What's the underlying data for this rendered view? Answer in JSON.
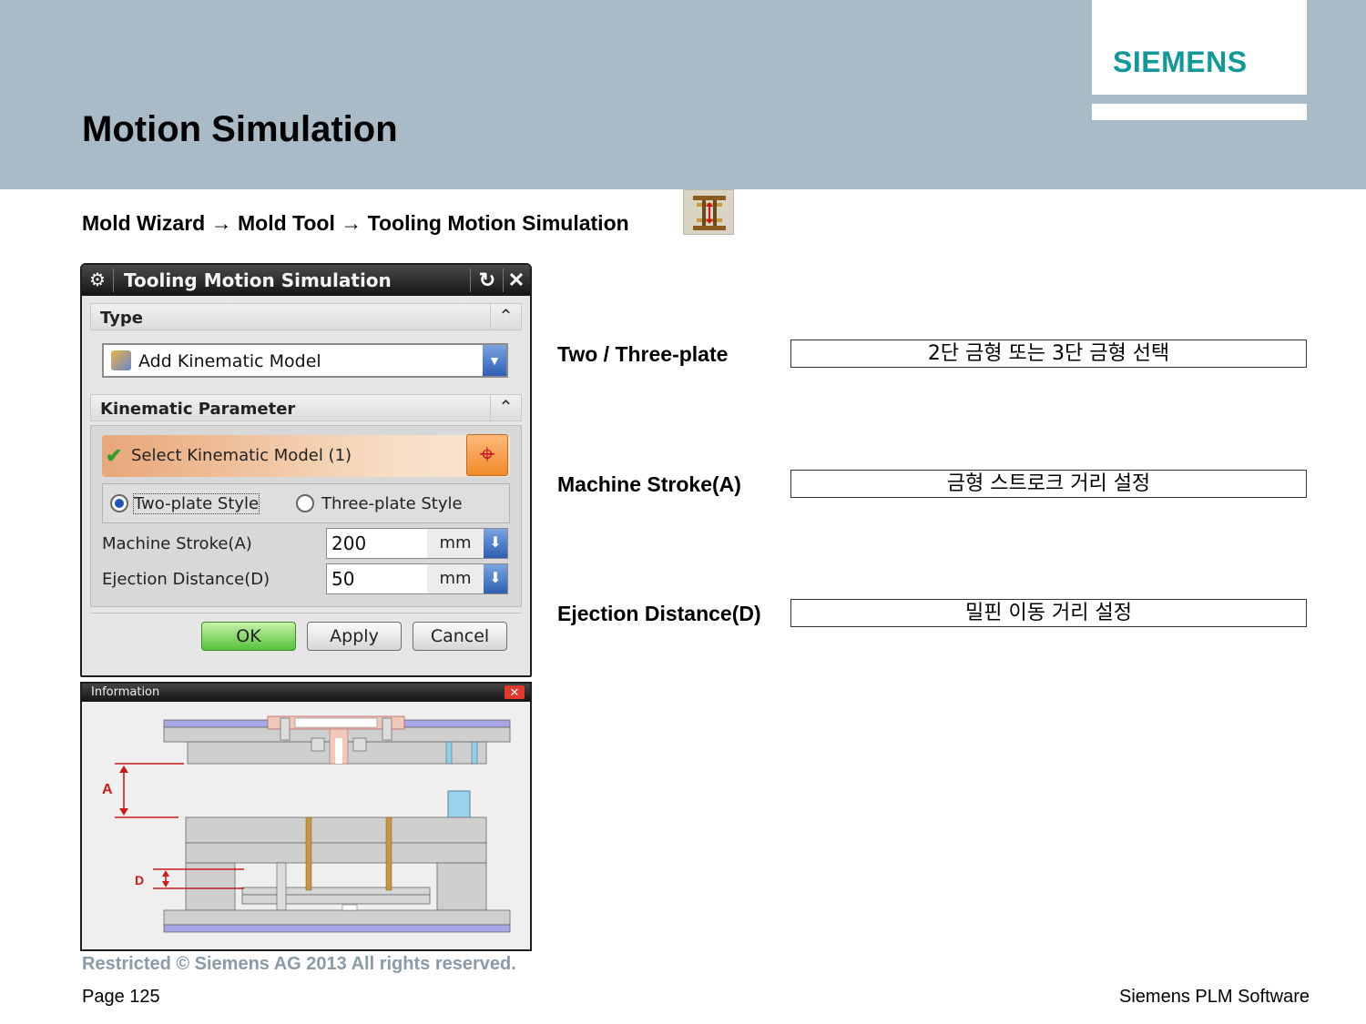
{
  "slide": {
    "title": "Motion Simulation",
    "logo": "SIEMENS",
    "menu_path": "Mold Wizard → Mold Tool → Tooling Motion Simulation",
    "menu_icon": "tooling-motion-icon"
  },
  "dialog": {
    "title": "Tooling Motion Simulation",
    "type_group": "Type",
    "type_value": "Add Kinematic Model",
    "kinematic_group": "Kinematic Parameter",
    "select_label": "Select Kinematic Model (1)",
    "radio_two": "Two-plate Style",
    "radio_three": "Three-plate Style",
    "selected_radio": "Two-plate Style",
    "machine_stroke_label": "Machine Stroke(A)",
    "machine_stroke_value": "200",
    "ejection_label": "Ejection Distance(D)",
    "ejection_value": "50",
    "unit": "mm",
    "ok": "OK",
    "apply": "Apply",
    "cancel": "Cancel"
  },
  "info_window": {
    "title": "Information",
    "label_a": "A",
    "label_d": "D"
  },
  "annotations": [
    {
      "label": "Two / Three-plate",
      "desc": "2단 금형 또는 3단 금형 선택"
    },
    {
      "label": "Machine Stroke(A)",
      "desc": "금형 스트로크 거리 설정"
    },
    {
      "label": "Ejection Distance(D)",
      "desc": "밀핀 이동 거리 설정"
    }
  ],
  "footer": {
    "copyright": "Restricted © Siemens AG 2013 All rights reserved.",
    "page": "Page 125",
    "brand": "Siemens PLM Software"
  },
  "colors": {
    "header_band": "#aabbc8",
    "logo": "#119999",
    "ok_button": "#55c23a",
    "select_highlight": "#e8a778"
  }
}
